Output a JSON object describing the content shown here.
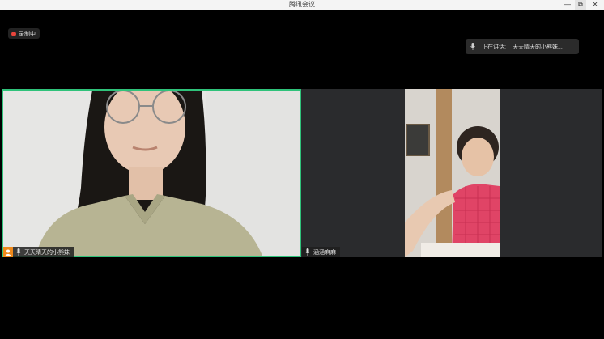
{
  "window": {
    "title": "腾讯会议",
    "min_glyph": "—",
    "max_glyph": "⧉",
    "close_glyph": "✕"
  },
  "recording": {
    "label": "录制中",
    "color": "#e8453c"
  },
  "speaking": {
    "label": "正在讲话:",
    "speaker": "天天晴天的小熊妹..."
  },
  "participants": [
    {
      "name": "天天晴天的小熊妹",
      "is_host": true,
      "active_speaker": true
    },
    {
      "name": "涵涵麻麻",
      "is_host": false,
      "active_speaker": false
    }
  ],
  "colors": {
    "active_border": "#2fc27a",
    "host_badge": "#f08a1c",
    "background": "#000000"
  }
}
